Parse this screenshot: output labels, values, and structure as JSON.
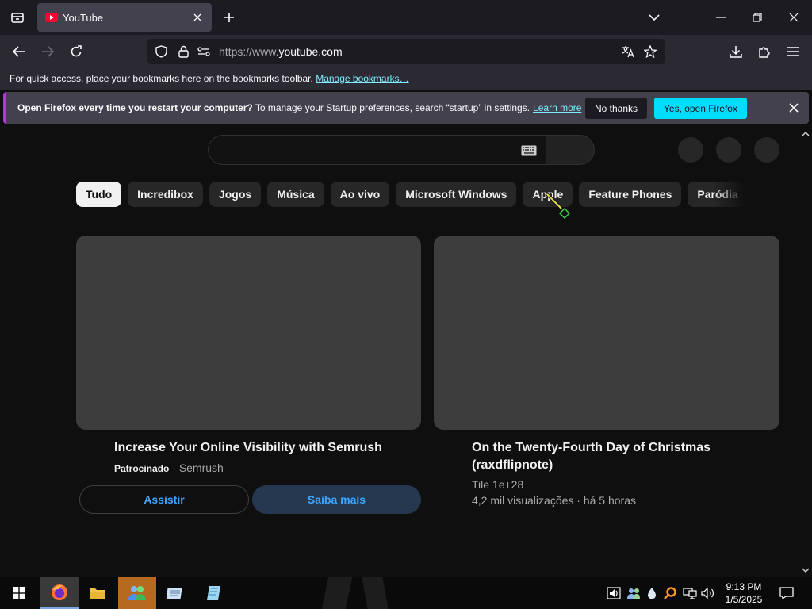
{
  "browser": {
    "tab": {
      "title": "YouTube"
    },
    "url": {
      "prefix": "https://www.",
      "domain": "youtube.com"
    },
    "bookmarks_bar": {
      "text": "For quick access, place your bookmarks here on the bookmarks toolbar.",
      "link": "Manage bookmarks…"
    },
    "notification": {
      "bold": "Open Firefox every time you restart your computer?",
      "text": "To manage your Startup preferences, search “startup” in settings.",
      "link": "Learn more",
      "no_label": "No thanks",
      "yes_label": "Yes, open Firefox"
    }
  },
  "youtube": {
    "chips": [
      "Tudo",
      "Incredibox",
      "Jogos",
      "Música",
      "Ao vivo",
      "Microsoft Windows",
      "Apple",
      "Feature Phones",
      "Paródia"
    ],
    "active_chip": "Tudo",
    "cards": [
      {
        "title": "Increase Your Online Visibility with Semrush",
        "sponsored": "Patrocinado",
        "separator": " · ",
        "channel": "Semrush",
        "buttons": {
          "watch": "Assistir",
          "learn_more": "Saiba mais"
        }
      },
      {
        "title_line1": "On the Twenty-Fourth Day of Christmas",
        "title_line2": "(raxdflipnote)",
        "channel": "Tile 1e+28",
        "stats": "4,2 mil visualizações · há 5 horas"
      }
    ]
  },
  "taskbar": {
    "clock_time": "9:13 PM",
    "clock_date": "1/5/2025"
  },
  "colors": {
    "accent_cyan": "#00ddff",
    "link_blue": "#3ea6ff",
    "yt_bg": "#0f0f0f",
    "notif_bar_purple": "#b833e1"
  }
}
